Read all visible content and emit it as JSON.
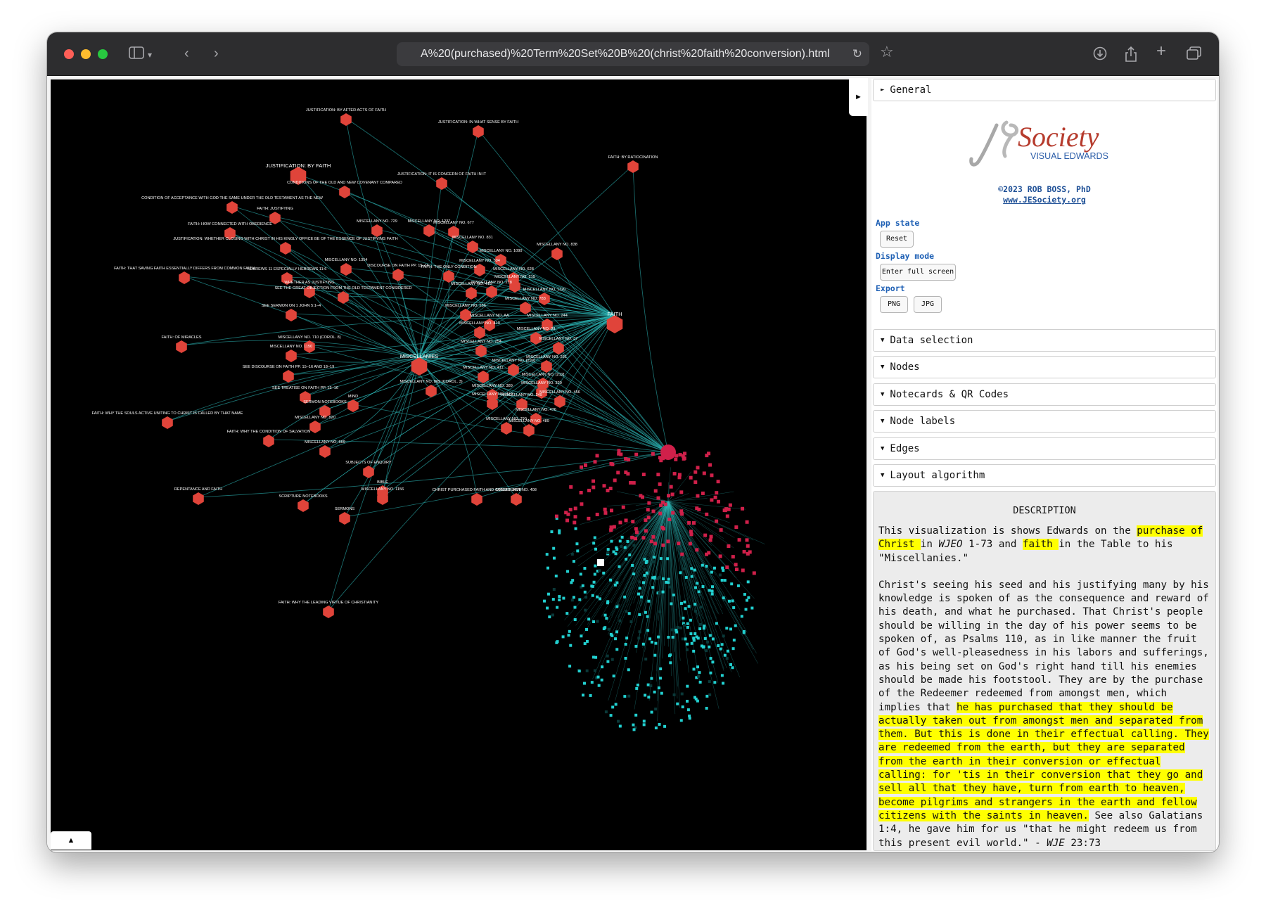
{
  "browser": {
    "url": "A%20(purchased)%20Term%20Set%20B%20(christ%20faith%20conversion).html"
  },
  "graph": {
    "collapse_tab": "►",
    "bottom_tab": "▲",
    "colors": {
      "node": "#e0443a",
      "edge": "#2bb3b3",
      "cluster_red": "#d0204a",
      "cluster_cyan": "#22d0d0"
    },
    "labels": [
      "JUSTIFICATION: BY AFTER ACTS OF FAITH",
      "JUSTIFICATION: IN WHAT SENSE BY FAITH",
      "FAITH: BY RATIOCINATION",
      "JUSTIFICATION: BY FAITH",
      "JUSTIFICATION: IT IS CONCERN OF FAITH IN IT",
      "CONDITIONS OF THE OLD AND NEW COVENANT COMPARED",
      "CONDITION OF ACCEPTANCE WITH GOD THE SAME UNDER THE OLD TESTAMENT AS THE NEW",
      "FAITH: JUSTIFYING",
      "FAITH: HOW CONNECTED WITH OBEDIENCE",
      "MISCELLANY NO. 729",
      "MISCELLANY NO. 1237",
      "MISCELLANY NO. 677",
      "MISCELLANY NO. 831",
      "MISCELLANY NO. 838",
      "JUSTIFICATION: WHETHER CLOSING WITH CHRIST IN HIS KINGLY OFFICE BE OF THE ESSENCE OF JUSTIFYING FAITH",
      "MISCELLANY NO. 1090",
      "MISCELLANY NO. 1354",
      "DISCOURSE ON FAITH PP. 15–16",
      "MISCELLANY NO. 504",
      "FAITH: THAT SAVING FAITH ESSENTIALLY DIFFERS FROM COMMON FAITH",
      "HEBREWS 11 ESPECIALLY HEBREWS 11:6",
      "FAITH: THE ONLY CONDITION",
      "MISCELLANY NO. 628",
      "MISCELLANY NO. 219",
      "MISCELLANY NO. 218",
      "MISCELLANY NO. 416",
      "WHETHER AS JUSTIFYING",
      "SEE THE GREAT OBJECTION FROM THE OLD TESTAMENT CONSIDERED",
      "MISCELLANY NO. 1120",
      "MISCELLANY NO. 783",
      "SEE SERMON ON 1 JOHN 5:1–4",
      "MISCELLANY NO. 256",
      "MISCELLANY NO. 244",
      "FAITH",
      "MISCELLANY NO. AA",
      "MISCELLANY NO. 419",
      "MISCELLANY NO. 33",
      "FAITH: OF MIRACLES",
      "MISCELLANY NO. 710 (COROL. 8)",
      "MISCELLANY NO. 1150",
      "MISCELLANY NO. 254",
      "MISCELLANY NO. 37",
      "MISCELLANIES",
      "MISCELLANY NO. [299]",
      "MISCELLANY NO. 291",
      "SEE DISCOURSE ON FAITH PP. 15–16 AND 18–19",
      "MISCELLANY NO. 411",
      "MISCELLANY NO. [212]",
      "MISCELLANY NO. 329",
      "MISCELLANY NO. 809 (COROL. 3)",
      "MISCELLANY NO. 389",
      "SEE TREATISE ON FAITH PP. 15–16",
      "MISCELLANY NO. 410",
      "MISCELLANY NO. 249",
      "MISCELLANY NO. 456",
      "SERMON NOTEBOOKS",
      "MIND",
      "FAITH: WHY THE SOULS ACTIVE UNITING TO CHRIST IS CALLED BY THAT NAME",
      "MISCELLANY NO. 820",
      "MISCELLANY NO. 476",
      "MISCELLANY NO. 790",
      "MISCELLANY NO. 489",
      "FAITH: WHY THE CONDITION OF SALVATION",
      "MISCELLANY NO. 669",
      "SUBJECTS OF ENQUIRY",
      "REPENTANCE AND FAITH",
      "BIBLE",
      "MISCELLANY NO. 1156",
      "CHRIST PURCHASED FAITH AND CONVERSION",
      "MISCELLANY NO. 408",
      "SCRIPTURE NOTEBOOKS",
      "SERMONS",
      "FAITH: WHY THE LEADING VIRTUE OF CHRISTIANITY"
    ]
  },
  "panel": {
    "general": "General",
    "logo_main": "Society",
    "logo_sub": "VISUAL EDWARDS",
    "copyright": "©2023 ROB BOSS, PhD",
    "website": "www.JESociety.org",
    "app_state": "App state",
    "reset": "Reset",
    "display_mode": "Display mode",
    "full_screen": "Enter full screen",
    "export": "Export",
    "png": "PNG",
    "jpg": "JPG",
    "sections": [
      "Data selection",
      "Nodes",
      "Notecards & QR Codes",
      "Node labels",
      "Edges",
      "Layout algorithm"
    ],
    "description_title": "DESCRIPTION",
    "desc": {
      "p1a": "This visualization is shows Edwards on the ",
      "p1b": "purchase of Christ ",
      "p1c": "in ",
      "p1d": "WJEO",
      "p1e": " 1-73 and ",
      "p1f": "faith ",
      "p1g": "in the Table to his \"Miscellanies.\"",
      "p2a": "Christ's seeing his seed and his justifying many by his knowledge is spoken of as the consequence and reward of his death, and what he purchased. That Christ's people should be willing in the day of his power seems to be spoken of, as Psalms 110, as in like manner the fruit of God's well-pleasedness in his labors and sufferings, as his being set on God's right hand till his enemies should be made his footstool. They are by the purchase of the Redeemer redeemed from amongst men, which implies that ",
      "p2b": "he has purchased that they should be actually taken out from amongst men and separated from them. But this is done in their effectual calling. They are redeemed from the earth, but they are separated from the earth in their conversion or effectual calling: for 'tis in their conversion that they go and sell all that they have, turn from earth to heaven, become pilgrims and strangers in the earth and fellow citizens with the saints in heaven.",
      "p2c": " See also Galatians 1:4, he gave him for us \"that he might redeem us from this present evil world.\" - ",
      "p2d": "WJE",
      "p2e": " 23:73"
    }
  }
}
